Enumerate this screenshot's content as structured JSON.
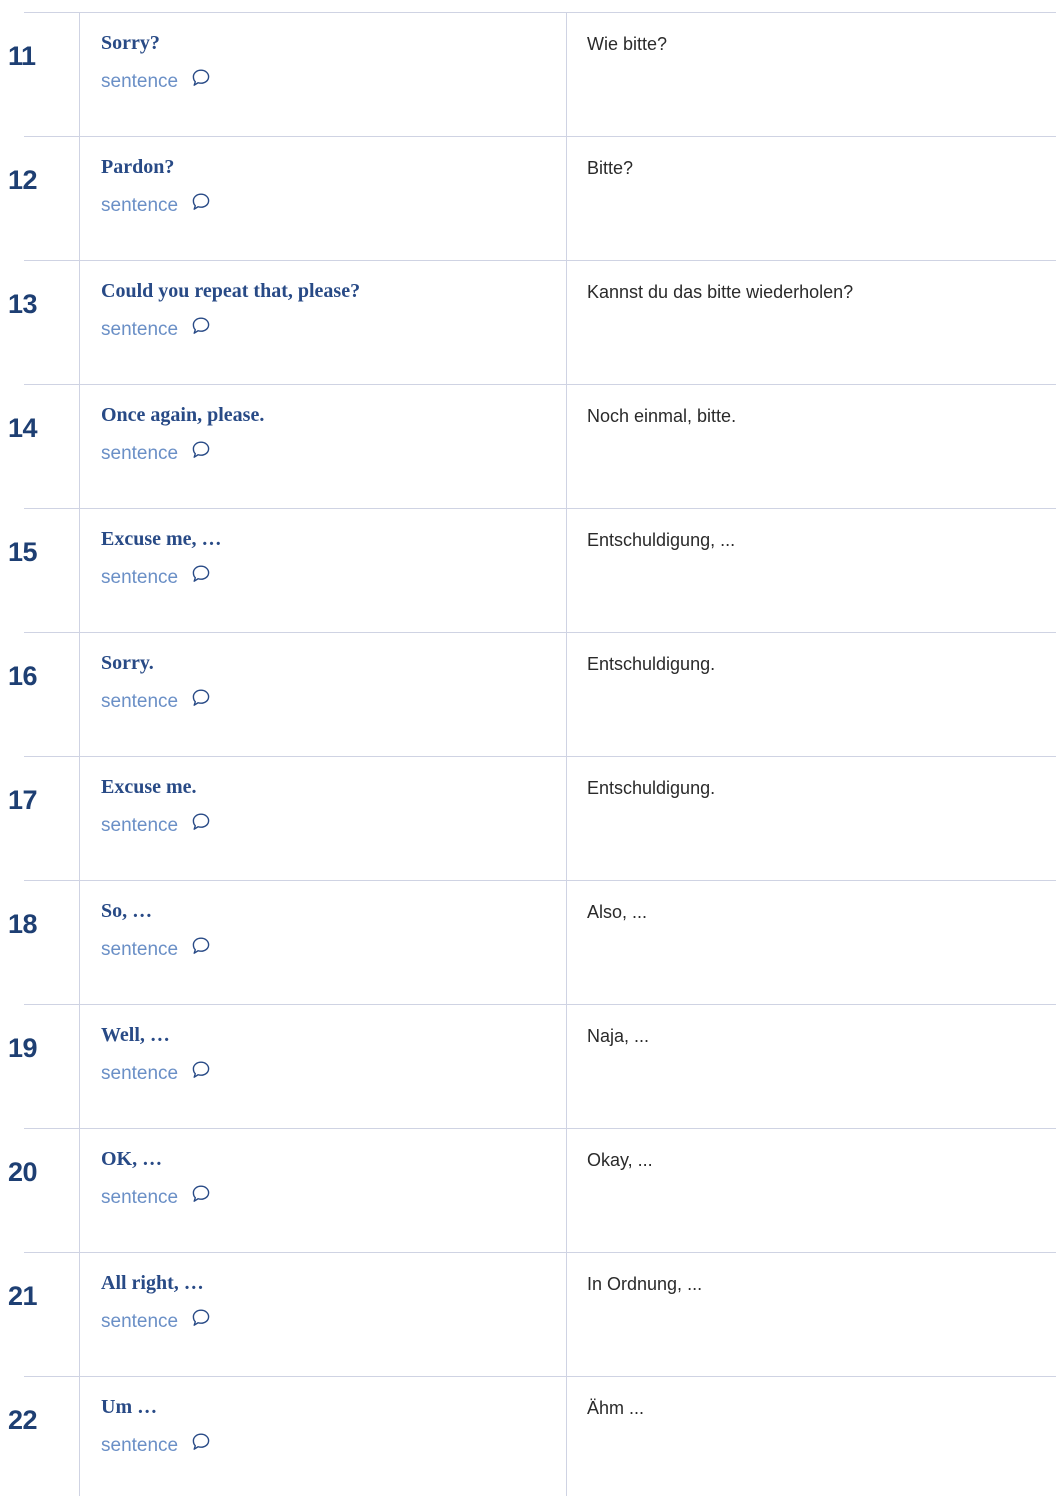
{
  "rows": [
    {
      "number": "11",
      "term": "Sorry?",
      "type": "sentence",
      "translation": "Wie bitte?"
    },
    {
      "number": "12",
      "term": "Pardon?",
      "type": "sentence",
      "translation": "Bitte?"
    },
    {
      "number": "13",
      "term": "Could you repeat that, please?",
      "type": "sentence",
      "translation": "Kannst du das bitte wiederholen?"
    },
    {
      "number": "14",
      "term": "Once again, please.",
      "type": "sentence",
      "translation": "Noch einmal, bitte."
    },
    {
      "number": "15",
      "term": "Excuse me, …",
      "type": "sentence",
      "translation": "Entschuldigung, ..."
    },
    {
      "number": "16",
      "term": "Sorry.",
      "type": "sentence",
      "translation": "Entschuldigung."
    },
    {
      "number": "17",
      "term": "Excuse me.",
      "type": "sentence",
      "translation": "Entschuldigung."
    },
    {
      "number": "18",
      "term": "So, …",
      "type": "sentence",
      "translation": "Also, ..."
    },
    {
      "number": "19",
      "term": "Well, …",
      "type": "sentence",
      "translation": "Naja, ..."
    },
    {
      "number": "20",
      "term": "OK, …",
      "type": "sentence",
      "translation": "Okay, ..."
    },
    {
      "number": "21",
      "term": "All right, …",
      "type": "sentence",
      "translation": "In Ordnung, ..."
    },
    {
      "number": "22",
      "term": "Um …",
      "type": "sentence",
      "translation": "Ähm ..."
    }
  ],
  "icons": {
    "comment": "speech-bubble-icon"
  },
  "colors": {
    "number": "#1e3f73",
    "term": "#284a86",
    "type": "#6a8fc6",
    "translation": "#2a2a2a",
    "rule": "#cfd3e3"
  }
}
